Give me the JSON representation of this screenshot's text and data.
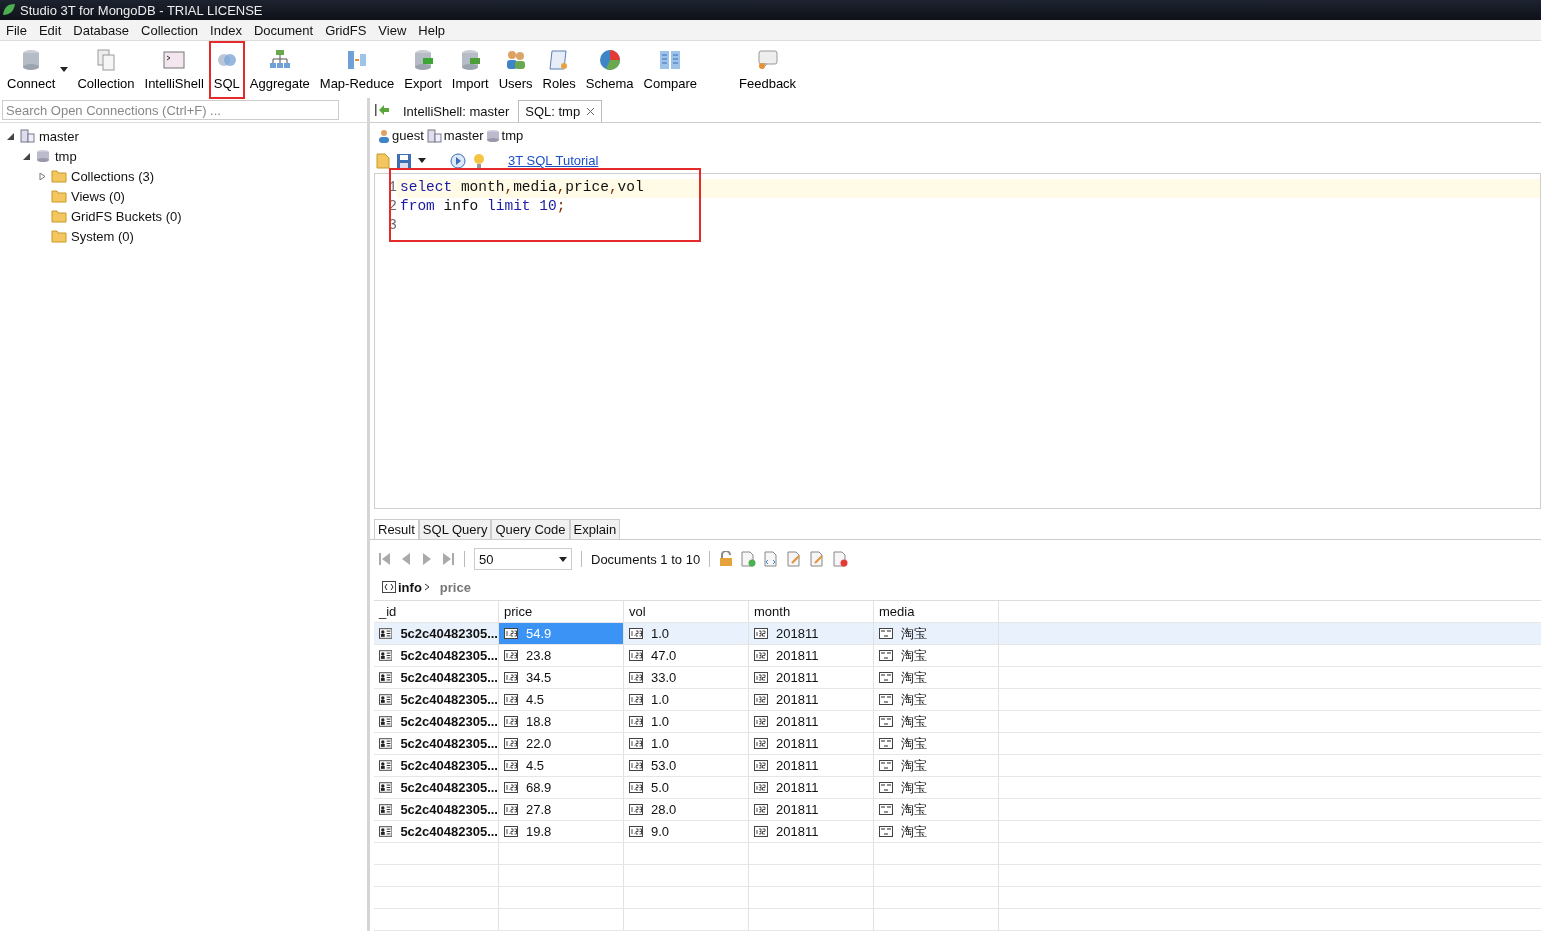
{
  "window": {
    "title": "Studio 3T for MongoDB - TRIAL LICENSE"
  },
  "menu": [
    "File",
    "Edit",
    "Database",
    "Collection",
    "Index",
    "Document",
    "GridFS",
    "View",
    "Help"
  ],
  "toolbar": [
    {
      "label": "Connect",
      "dropdown": true,
      "highlighted": false
    },
    {
      "label": "Collection",
      "dropdown": false,
      "highlighted": false
    },
    {
      "label": "IntelliShell",
      "dropdown": false,
      "highlighted": false
    },
    {
      "label": "SQL",
      "dropdown": false,
      "highlighted": true
    },
    {
      "label": "Aggregate",
      "dropdown": false,
      "highlighted": false
    },
    {
      "label": "Map-Reduce",
      "dropdown": false,
      "highlighted": false
    },
    {
      "label": "Export",
      "dropdown": false,
      "highlighted": false
    },
    {
      "label": "Import",
      "dropdown": false,
      "highlighted": false
    },
    {
      "label": "Users",
      "dropdown": false,
      "highlighted": false
    },
    {
      "label": "Roles",
      "dropdown": false,
      "highlighted": false
    },
    {
      "label": "Schema",
      "dropdown": false,
      "highlighted": false
    },
    {
      "label": "Compare",
      "dropdown": false,
      "highlighted": false
    },
    {
      "label": "Feedback",
      "dropdown": false,
      "highlighted": false
    }
  ],
  "search": {
    "placeholder": "Search Open Connections (Ctrl+F) ..."
  },
  "tabs": [
    {
      "label": "IntelliShell: master",
      "selected": false,
      "closable": false
    },
    {
      "label": "SQL: tmp",
      "selected": true,
      "closable": true
    }
  ],
  "tree": [
    {
      "label": "master",
      "kind": "server",
      "expanded": true,
      "children": [
        {
          "label": "tmp",
          "kind": "database",
          "expanded": true,
          "children": [
            {
              "label": "Collections (3)",
              "kind": "folder",
              "expanded": false
            },
            {
              "label": "Views (0)",
              "kind": "folder"
            },
            {
              "label": "GridFS Buckets (0)",
              "kind": "folder"
            },
            {
              "label": "System (0)",
              "kind": "folder"
            }
          ]
        }
      ]
    }
  ],
  "context": {
    "user": "guest",
    "connection": "master",
    "database": "tmp"
  },
  "tutorial_link": "3T SQL Tutorial",
  "editor": {
    "highlighted": true,
    "lines": [
      {
        "number": "1",
        "tokens": [
          {
            "text": "select",
            "kind": "keyword"
          },
          {
            "text": " month",
            "kind": "plain"
          },
          {
            "text": ",",
            "kind": "punct"
          },
          {
            "text": "media",
            "kind": "plain"
          },
          {
            "text": ",",
            "kind": "punct"
          },
          {
            "text": "price",
            "kind": "plain"
          },
          {
            "text": ",",
            "kind": "punct"
          },
          {
            "text": "vol",
            "kind": "plain"
          }
        ]
      },
      {
        "number": "2",
        "tokens": [
          {
            "text": "from",
            "kind": "keyword"
          },
          {
            "text": " info ",
            "kind": "plain"
          },
          {
            "text": "limit",
            "kind": "keyword"
          },
          {
            "text": " 10",
            "kind": "number"
          },
          {
            "text": ";",
            "kind": "punct"
          }
        ]
      },
      {
        "number": "3"
      }
    ]
  },
  "result_tabs": [
    {
      "label": "Result",
      "selected": true
    },
    {
      "label": "SQL Query",
      "selected": false
    },
    {
      "label": "Query Code",
      "selected": false
    },
    {
      "label": "Explain",
      "selected": false
    }
  ],
  "pager": {
    "page_size": "50",
    "range": "Documents 1 to 10"
  },
  "path": {
    "collection": "info",
    "field": "price"
  },
  "table": {
    "columns": [
      "_id",
      "price",
      "vol",
      "month",
      "media"
    ],
    "rows": [
      {
        "selected": true,
        "cells": [
          {
            "text": "5c2c40482305...",
            "selected": false
          },
          {
            "text": "54.9",
            "selected": true
          },
          {
            "text": "1.0",
            "selected": false
          },
          {
            "text": "201811",
            "selected": false
          },
          {
            "text": "淘宝",
            "selected": false
          }
        ]
      },
      {
        "selected": false,
        "cells": [
          {
            "text": "5c2c40482305...",
            "selected": false
          },
          {
            "text": "23.8",
            "selected": false
          },
          {
            "text": "47.0",
            "selected": false
          },
          {
            "text": "201811",
            "selected": false
          },
          {
            "text": "淘宝",
            "selected": false
          }
        ]
      },
      {
        "selected": false,
        "cells": [
          {
            "text": "5c2c40482305...",
            "selected": false
          },
          {
            "text": "34.5",
            "selected": false
          },
          {
            "text": "33.0",
            "selected": false
          },
          {
            "text": "201811",
            "selected": false
          },
          {
            "text": "淘宝",
            "selected": false
          }
        ]
      },
      {
        "selected": false,
        "cells": [
          {
            "text": "5c2c40482305...",
            "selected": false
          },
          {
            "text": "4.5",
            "selected": false
          },
          {
            "text": "1.0",
            "selected": false
          },
          {
            "text": "201811",
            "selected": false
          },
          {
            "text": "淘宝",
            "selected": false
          }
        ]
      },
      {
        "selected": false,
        "cells": [
          {
            "text": "5c2c40482305...",
            "selected": false
          },
          {
            "text": "18.8",
            "selected": false
          },
          {
            "text": "1.0",
            "selected": false
          },
          {
            "text": "201811",
            "selected": false
          },
          {
            "text": "淘宝",
            "selected": false
          }
        ]
      },
      {
        "selected": false,
        "cells": [
          {
            "text": "5c2c40482305...",
            "selected": false
          },
          {
            "text": "22.0",
            "selected": false
          },
          {
            "text": "1.0",
            "selected": false
          },
          {
            "text": "201811",
            "selected": false
          },
          {
            "text": "淘宝",
            "selected": false
          }
        ]
      },
      {
        "selected": false,
        "cells": [
          {
            "text": "5c2c40482305...",
            "selected": false
          },
          {
            "text": "4.5",
            "selected": false
          },
          {
            "text": "53.0",
            "selected": false
          },
          {
            "text": "201811",
            "selected": false
          },
          {
            "text": "淘宝",
            "selected": false
          }
        ]
      },
      {
        "selected": false,
        "cells": [
          {
            "text": "5c2c40482305...",
            "selected": false
          },
          {
            "text": "68.9",
            "selected": false
          },
          {
            "text": "5.0",
            "selected": false
          },
          {
            "text": "201811",
            "selected": false
          },
          {
            "text": "淘宝",
            "selected": false
          }
        ]
      },
      {
        "selected": false,
        "cells": [
          {
            "text": "5c2c40482305...",
            "selected": false
          },
          {
            "text": "27.8",
            "selected": false
          },
          {
            "text": "28.0",
            "selected": false
          },
          {
            "text": "201811",
            "selected": false
          },
          {
            "text": "淘宝",
            "selected": false
          }
        ]
      },
      {
        "selected": false,
        "cells": [
          {
            "text": "5c2c40482305...",
            "selected": false
          },
          {
            "text": "19.8",
            "selected": false
          },
          {
            "text": "9.0",
            "selected": false
          },
          {
            "text": "201811",
            "selected": false
          },
          {
            "text": "淘宝",
            "selected": false
          }
        ]
      }
    ]
  }
}
